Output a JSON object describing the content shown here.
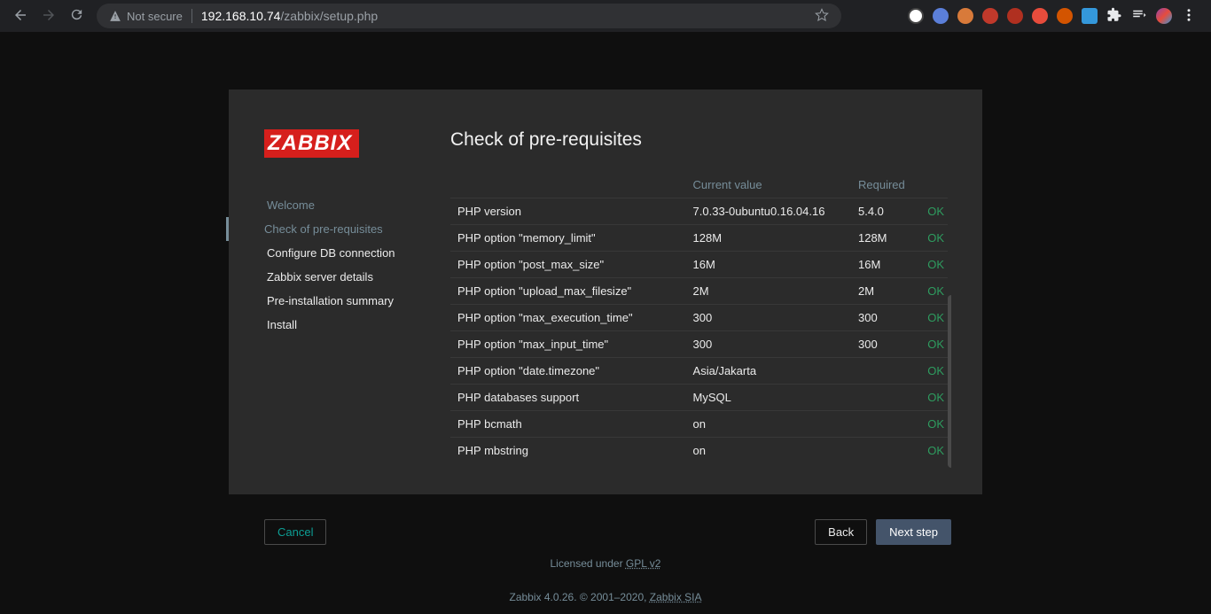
{
  "browser": {
    "not_secure": "Not secure",
    "host": "192.168.10.74",
    "path": "/zabbix/setup.php"
  },
  "logo": "ZABBIX",
  "page_title": "Check of pre-requisites",
  "steps": [
    "Welcome",
    "Check of pre-requisites",
    "Configure DB connection",
    "Zabbix server details",
    "Pre-installation summary",
    "Install"
  ],
  "table": {
    "headers": {
      "name": "",
      "current": "Current value",
      "required": "Required",
      "status": ""
    },
    "rows": [
      {
        "name": "PHP version",
        "current": "7.0.33-0ubuntu0.16.04.16",
        "required": "5.4.0",
        "status": "OK"
      },
      {
        "name": "PHP option \"memory_limit\"",
        "current": "128M",
        "required": "128M",
        "status": "OK"
      },
      {
        "name": "PHP option \"post_max_size\"",
        "current": "16M",
        "required": "16M",
        "status": "OK"
      },
      {
        "name": "PHP option \"upload_max_filesize\"",
        "current": "2M",
        "required": "2M",
        "status": "OK"
      },
      {
        "name": "PHP option \"max_execution_time\"",
        "current": "300",
        "required": "300",
        "status": "OK"
      },
      {
        "name": "PHP option \"max_input_time\"",
        "current": "300",
        "required": "300",
        "status": "OK"
      },
      {
        "name": "PHP option \"date.timezone\"",
        "current": "Asia/Jakarta",
        "required": "",
        "status": "OK"
      },
      {
        "name": "PHP databases support",
        "current": "MySQL",
        "required": "",
        "status": "OK"
      },
      {
        "name": "PHP bcmath",
        "current": "on",
        "required": "",
        "status": "OK"
      },
      {
        "name": "PHP mbstring",
        "current": "on",
        "required": "",
        "status": "OK"
      }
    ]
  },
  "buttons": {
    "cancel": "Cancel",
    "back": "Back",
    "next": "Next step"
  },
  "footer": {
    "licensed": "Licensed under ",
    "license_link": "GPL v2",
    "version": "Zabbix 4.0.26. © 2001–2020, ",
    "company_link": "Zabbix SIA"
  }
}
